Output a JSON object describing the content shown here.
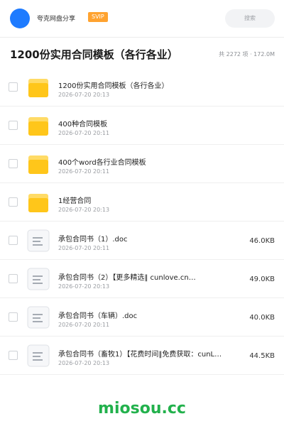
{
  "header": {
    "app_name": "夸克网盘分享",
    "badge": "SVIP",
    "search_placeholder": "搜索",
    "avatar_color": "#1e7bff",
    "badge_color": "#ffa330"
  },
  "folder": {
    "title": "1200份实用合同模板（各行各业）",
    "summary": "共 2272 项 · 172.0M"
  },
  "items": [
    {
      "type": "folder",
      "name": "1200份实用合同模板（各行各业）",
      "date": "2026-07-20 20:13",
      "size": ""
    },
    {
      "type": "folder",
      "name": "400种合同模板",
      "date": "2026-07-20 20:11",
      "size": ""
    },
    {
      "type": "folder",
      "name": "400个word各行业合同模板",
      "date": "2026-07-20 20:11",
      "size": ""
    },
    {
      "type": "folder",
      "name": "1经营合同",
      "date": "2026-07-20 20:13",
      "size": ""
    },
    {
      "type": "file",
      "name": "承包合同书（1）.doc",
      "date": "2026-07-20 20:11",
      "size": "46.0KB"
    },
    {
      "type": "file",
      "name": "承包合同书（2）【更多精选‖ cunlove.cn…",
      "date": "2026-07-20 20:13",
      "size": "49.0KB"
    },
    {
      "type": "file",
      "name": "承包合同书（车辆）.doc",
      "date": "2026-07-20 20:11",
      "size": "40.0KB"
    },
    {
      "type": "file",
      "name": "承包合同书（畜牧1）【花费时间‖免费获取：cunL…",
      "date": "2026-07-20 20:13",
      "size": "44.5KB"
    }
  ],
  "watermark": "miosou.cc",
  "colors": {
    "folder_icon": "#ffc61a",
    "folder_tab": "#ffdb66",
    "watermark": "#22b14c"
  }
}
